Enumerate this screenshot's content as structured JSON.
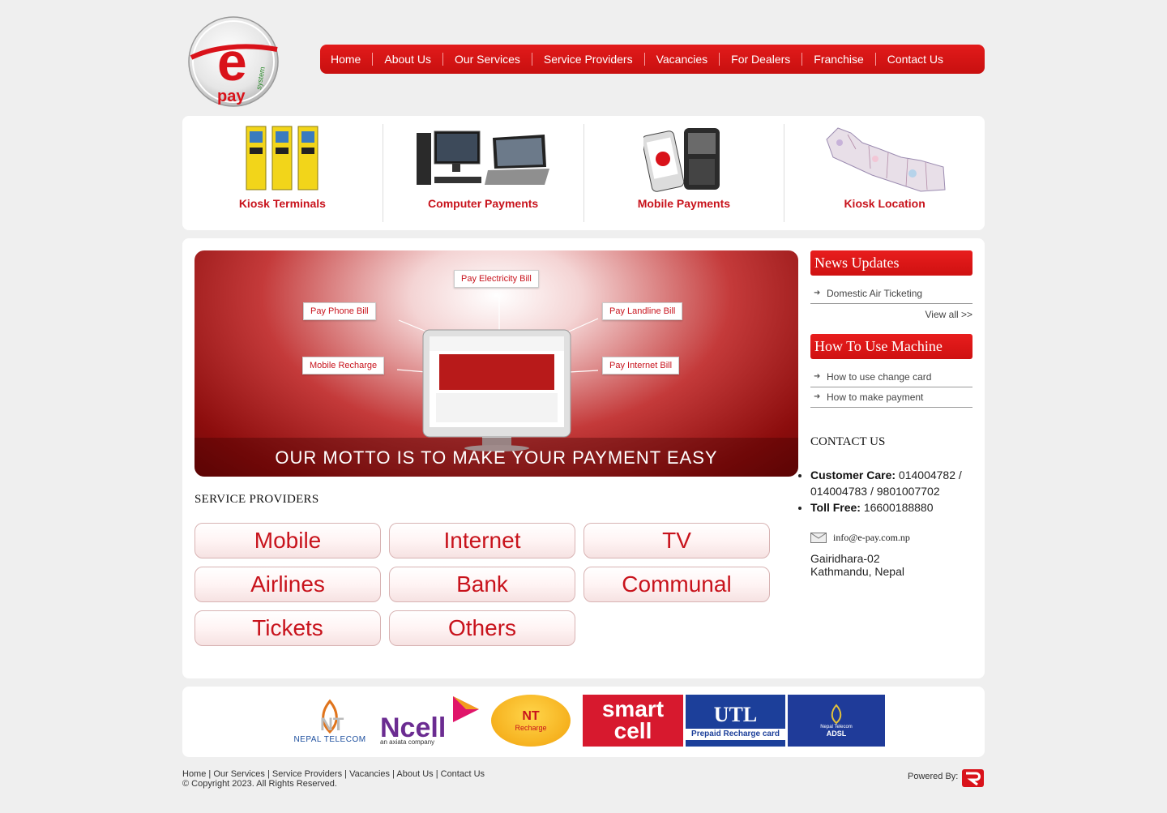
{
  "nav": [
    "Home",
    "About Us",
    "Our Services",
    "Service Providers",
    "Vacancies",
    "For Dealers",
    "Franchise",
    "Contact Us"
  ],
  "features": [
    {
      "label": "Kiosk Terminals"
    },
    {
      "label": "Computer Payments"
    },
    {
      "label": "Mobile Payments"
    },
    {
      "label": "Kiosk Location"
    }
  ],
  "banner": {
    "bills": [
      "Pay Electricity Bill",
      "Pay Phone Bill",
      "Pay Landline Bill",
      "Mobile Recharge",
      "Pay Internet Bill"
    ],
    "motto": "OUR MOTTO IS TO MAKE YOUR PAYMENT EASY"
  },
  "service_providers": {
    "title": "SERVICE PROVIDERS",
    "items": [
      "Mobile",
      "Internet",
      "TV",
      "Airlines",
      "Bank",
      "Communal",
      "Tickets",
      "Others"
    ]
  },
  "news": {
    "title": "News Updates",
    "items": [
      "Domestic Air Ticketing"
    ],
    "view_all": "View all >>"
  },
  "howto": {
    "title": "How To Use Machine",
    "items": [
      "How to use change card",
      "How to make payment"
    ]
  },
  "contact": {
    "title": "CONTACT US",
    "customer_care_label": "Customer Care:",
    "customer_care_value": " 014004782 / 014004783 / 9801007702",
    "toll_free_label": "Toll Free:",
    "toll_free_value": " 16600188880",
    "email": "info@e-pay.com.np",
    "address_line1": "Gairidhara-02",
    "address_line2": "Kathmandu, Nepal"
  },
  "partners": {
    "nt_text": "NEPAL TELECOM",
    "ncell_text": "Ncell",
    "ncell_sub": "an axiata company",
    "ntr_text": "NT",
    "ntr_sub": "Recharge",
    "smartcell_line1": "smart",
    "smartcell_line2": "cell",
    "utl_text": "UTL",
    "utl_sub": "Prepaid Recharge card",
    "adsl_line1": "Nepal Telecom",
    "adsl_line2": "ADSL"
  },
  "footer": {
    "links": [
      "Home",
      "Our Services",
      "Service Providers",
      "Vacancies",
      "About Us",
      "Contact Us"
    ],
    "copyright": "© Copyright 2023. All Rights Reserved.",
    "powered_by": "Powered By:"
  },
  "colors": {
    "brand_red": "#c8131c",
    "nav_red": "#d41414"
  }
}
